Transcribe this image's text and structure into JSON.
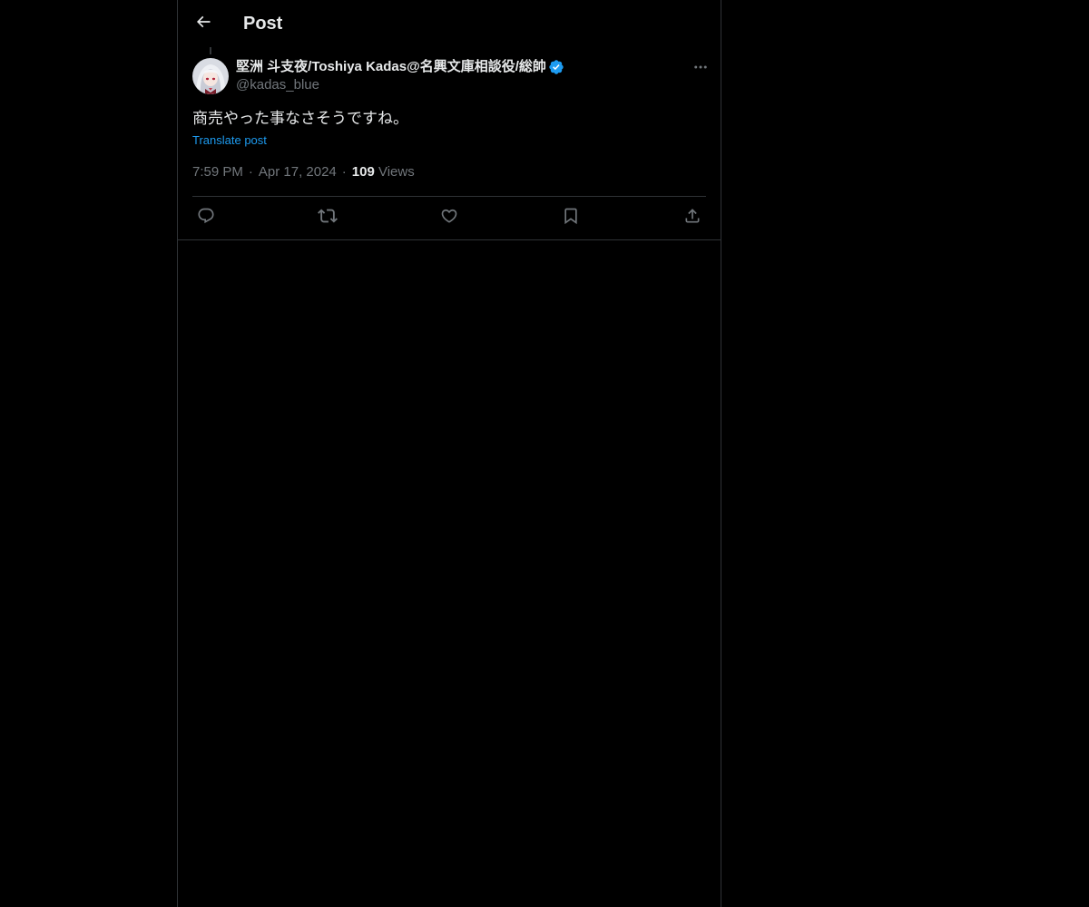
{
  "header": {
    "title": "Post",
    "back_icon": "arrow-left-icon"
  },
  "post": {
    "author": {
      "display_name": "堅洲 斗支夜/Toshiya Kadas@名興文庫相談役/総帥",
      "handle": "@kadas_blue",
      "verified": true,
      "verified_color": "#1d9bf0"
    },
    "text": "商売やった事なさそうですね。",
    "translate_label": "Translate post",
    "time": "7:59 PM",
    "date": "Apr 17, 2024",
    "views_count": "109",
    "views_label": "Views"
  },
  "actions": [
    {
      "name": "reply",
      "icon": "reply-icon"
    },
    {
      "name": "repost",
      "icon": "repost-icon"
    },
    {
      "name": "like",
      "icon": "heart-icon"
    },
    {
      "name": "bookmark",
      "icon": "bookmark-icon"
    },
    {
      "name": "share",
      "icon": "share-icon"
    }
  ],
  "colors": {
    "background": "#000000",
    "text": "#e7e9ea",
    "secondary": "#71767b",
    "accent": "#1d9bf0",
    "border": "#2f3336"
  }
}
